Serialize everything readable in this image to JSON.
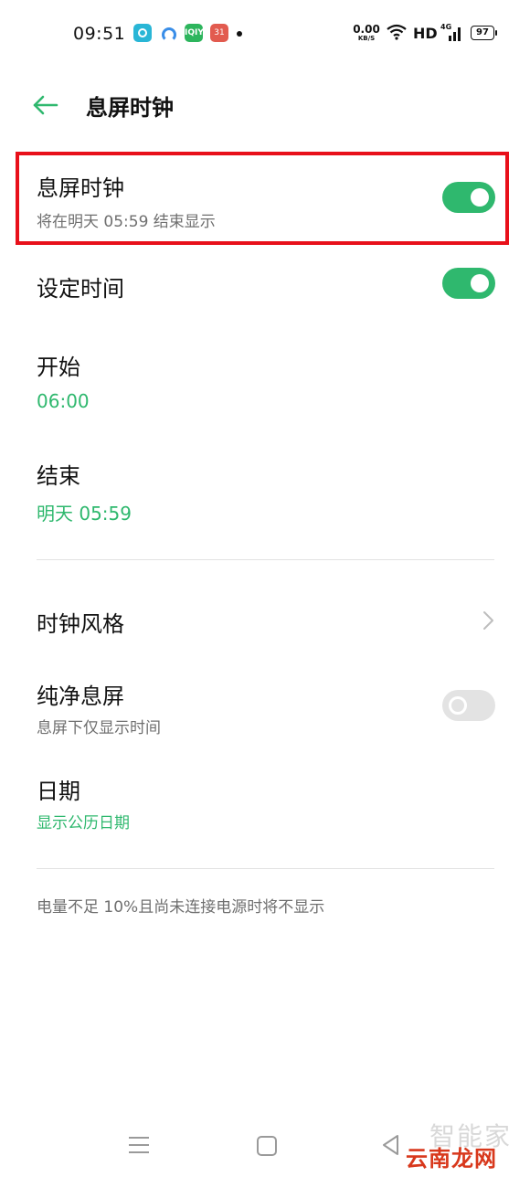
{
  "status_bar": {
    "time": "09:51",
    "net_speed_value": "0.00",
    "net_speed_unit": "KB/S",
    "hd_label": "HD",
    "signal_label": "4G",
    "battery_level": "97",
    "app_icons": [
      "camera-app-icon",
      "browser-app-icon",
      "iqiyi-app-icon",
      "calendar-app-icon"
    ],
    "iqiyi_text": "IQIY",
    "calendar_text": "31"
  },
  "header": {
    "title": "息屏时钟",
    "back_icon": "arrow-left-icon"
  },
  "settings": {
    "aod": {
      "title": "息屏时钟",
      "subtitle": "将在明天  05:59 结束显示",
      "enabled": true
    },
    "schedule": {
      "title": "设定时间",
      "enabled": true
    },
    "start": {
      "title": "开始",
      "value": "06:00"
    },
    "end": {
      "title": "结束",
      "value": "明天 05:59"
    },
    "clock_style": {
      "title": "时钟风格"
    },
    "pure_aod": {
      "title": "纯净息屏",
      "subtitle": "息屏下仅显示时间",
      "enabled": false
    },
    "date": {
      "title": "日期",
      "value": "显示公历日期"
    }
  },
  "footnote": "电量不足 10%且尚未连接电源时将不显示",
  "watermark": {
    "line1": "智能家",
    "line2": "云南龙网"
  },
  "colors": {
    "accent_green": "#2fb86e",
    "highlight_red": "#e8101a",
    "toggle_off": "#e3e3e3"
  }
}
